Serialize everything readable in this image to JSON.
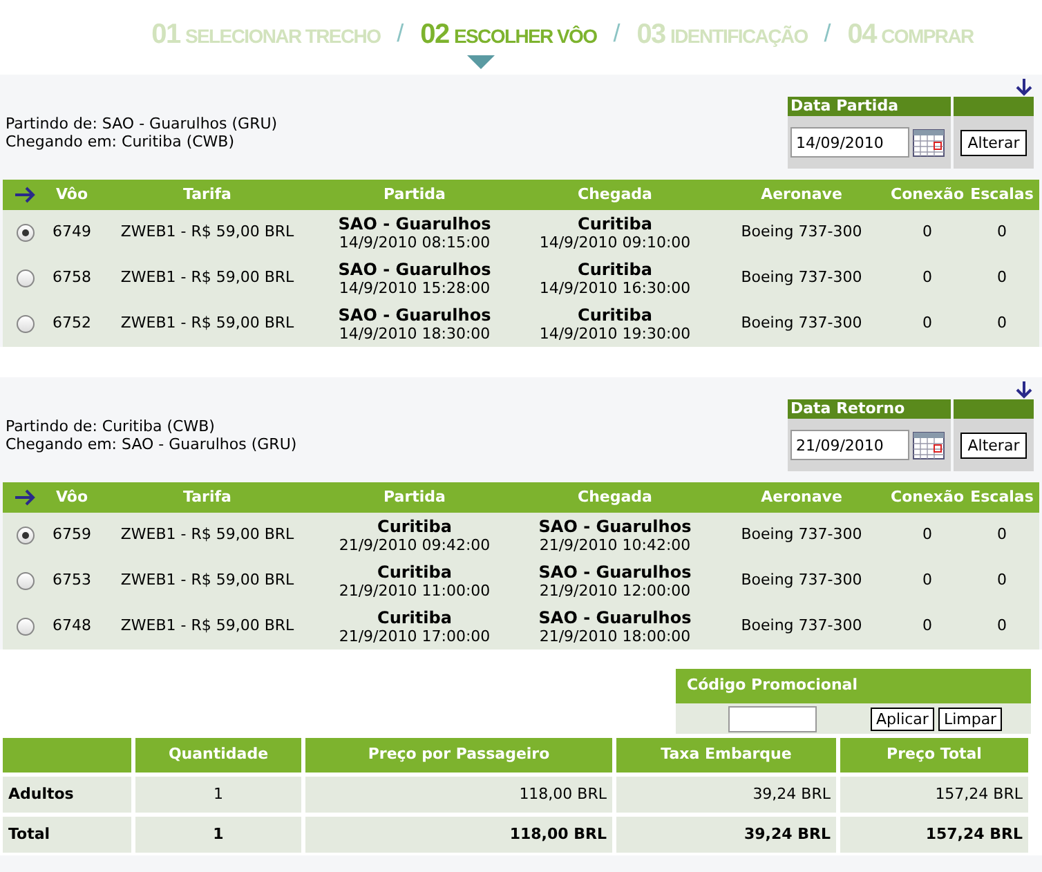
{
  "steps": [
    {
      "number": "01",
      "label": "SELECIONAR TRECHO",
      "selected": false
    },
    {
      "number": "02",
      "label": "ESCOLHER VÔO",
      "selected": true
    },
    {
      "number": "03",
      "label": "IDENTIFICAÇÃO",
      "selected": false
    },
    {
      "number": "04",
      "label": "COMPRAR",
      "selected": false
    }
  ],
  "separator": "/",
  "legs": [
    {
      "origin": "Partindo de: SAO - Guarulhos (GRU)",
      "destination": "Chegando em: Curitiba (CWB)",
      "date_label": "Data Partida",
      "date_value": "14/09/2010",
      "button": "Alterar",
      "columns": [
        "Vôo",
        "Tarifa",
        "Partida",
        "Chegada",
        "Aeronave",
        "Conexão",
        "Escalas"
      ],
      "flights": [
        {
          "selected": true,
          "flight": "6749",
          "fare": "ZWEB1 - R$ 59,00 BRL",
          "dep_place": "SAO - Guarulhos",
          "dep_time": "14/9/2010 08:15:00",
          "arr_place": "Curitiba",
          "arr_time": "14/9/2010 09:10:00",
          "aircraft": "Boeing 737-300",
          "connection": "0",
          "stops": "0"
        },
        {
          "selected": false,
          "flight": "6758",
          "fare": "ZWEB1 - R$ 59,00 BRL",
          "dep_place": "SAO - Guarulhos",
          "dep_time": "14/9/2010 15:28:00",
          "arr_place": "Curitiba",
          "arr_time": "14/9/2010 16:30:00",
          "aircraft": "Boeing 737-300",
          "connection": "0",
          "stops": "0"
        },
        {
          "selected": false,
          "flight": "6752",
          "fare": "ZWEB1 - R$ 59,00 BRL",
          "dep_place": "SAO - Guarulhos",
          "dep_time": "14/9/2010 18:30:00",
          "arr_place": "Curitiba",
          "arr_time": "14/9/2010 19:30:00",
          "aircraft": "Boeing 737-300",
          "connection": "0",
          "stops": "0"
        }
      ]
    },
    {
      "origin": "Partindo de: Curitiba (CWB)",
      "destination": "Chegando em: SAO - Guarulhos (GRU)",
      "date_label": "Data Retorno",
      "date_value": "21/09/2010",
      "button": "Alterar",
      "columns": [
        "Vôo",
        "Tarifa",
        "Partida",
        "Chegada",
        "Aeronave",
        "Conexão",
        "Escalas"
      ],
      "flights": [
        {
          "selected": true,
          "flight": "6759",
          "fare": "ZWEB1 - R$ 59,00 BRL",
          "dep_place": "Curitiba",
          "dep_time": "21/9/2010 09:42:00",
          "arr_place": "SAO - Guarulhos",
          "arr_time": "21/9/2010 10:42:00",
          "aircraft": "Boeing 737-300",
          "connection": "0",
          "stops": "0"
        },
        {
          "selected": false,
          "flight": "6753",
          "fare": "ZWEB1 - R$ 59,00 BRL",
          "dep_place": "Curitiba",
          "dep_time": "21/9/2010 11:00:00",
          "arr_place": "SAO - Guarulhos",
          "arr_time": "21/9/2010 12:00:00",
          "aircraft": "Boeing 737-300",
          "connection": "0",
          "stops": "0"
        },
        {
          "selected": false,
          "flight": "6748",
          "fare": "ZWEB1 - R$ 59,00 BRL",
          "dep_place": "Curitiba",
          "dep_time": "21/9/2010 17:00:00",
          "arr_place": "SAO - Guarulhos",
          "arr_time": "21/9/2010 18:00:00",
          "aircraft": "Boeing 737-300",
          "connection": "0",
          "stops": "0"
        }
      ]
    }
  ],
  "promo": {
    "title": "Código Promocional",
    "apply": "Aplicar",
    "clear": "Limpar"
  },
  "summary": {
    "columns": [
      "Quantidade",
      "Preço por Passageiro",
      "Taxa Embarque",
      "Preço Total"
    ],
    "rows": [
      {
        "kind": "normal",
        "label": "Adultos",
        "quantity": "1",
        "price": "118,00 BRL",
        "tax": "39,24 BRL",
        "total": "157,24 BRL"
      },
      {
        "kind": "total",
        "label": "Total",
        "quantity": "1",
        "price": "118,00 BRL",
        "tax": "39,24 BRL",
        "total": "157,24 BRL"
      }
    ]
  }
}
